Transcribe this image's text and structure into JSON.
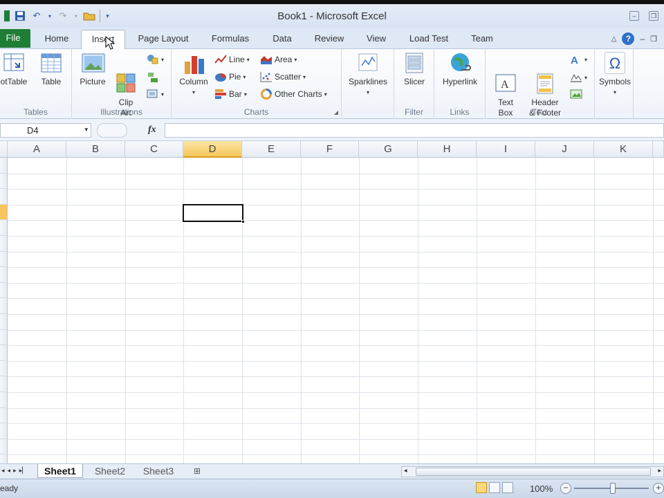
{
  "window": {
    "title": "Book1  -  Microsoft Excel"
  },
  "tabs": [
    {
      "label": "File"
    },
    {
      "label": "Home"
    },
    {
      "label": "Insert"
    },
    {
      "label": "Page Layout"
    },
    {
      "label": "Formulas"
    },
    {
      "label": "Data"
    },
    {
      "label": "Review"
    },
    {
      "label": "View"
    },
    {
      "label": "Load Test"
    },
    {
      "label": "Team"
    }
  ],
  "ribbon": {
    "tables": {
      "label": "Tables",
      "pivot": "otTable",
      "table": "Table"
    },
    "illustrations": {
      "label": "Illustrations",
      "picture": "Picture",
      "clipart": "Clip\nArt"
    },
    "charts": {
      "label": "Charts",
      "column": "Column",
      "line": "Line",
      "pie": "Pie",
      "bar": "Bar",
      "area": "Area",
      "scatter": "Scatter",
      "other": "Other Charts"
    },
    "sparklines": {
      "label": "Sparklines"
    },
    "filter": {
      "label": "Filter",
      "slicer": "Slicer"
    },
    "links": {
      "label": "Links",
      "hyperlink": "Hyperlink"
    },
    "text": {
      "label": "Text",
      "textbox": "Text\nBox",
      "header": "Header\n& Footer"
    },
    "symbols": {
      "label": "Symbols",
      "symbol_glyph": "Ω"
    }
  },
  "formula": {
    "namebox": "D4",
    "fx": "fx",
    "value": ""
  },
  "columns": [
    "A",
    "B",
    "C",
    "D",
    "E",
    "F",
    "G",
    "H",
    "I",
    "J",
    "K"
  ],
  "selected": {
    "column": "D",
    "row": 4
  },
  "sheets": [
    "Sheet1",
    "Sheet2",
    "Sheet3"
  ],
  "active_sheet": "Sheet1",
  "status": {
    "text": "eady",
    "zoom": "100%"
  },
  "colors": {
    "file_tab": "#1f7d35",
    "selection": "#f7c65b",
    "ribbon_bg": "#eef3fa"
  }
}
